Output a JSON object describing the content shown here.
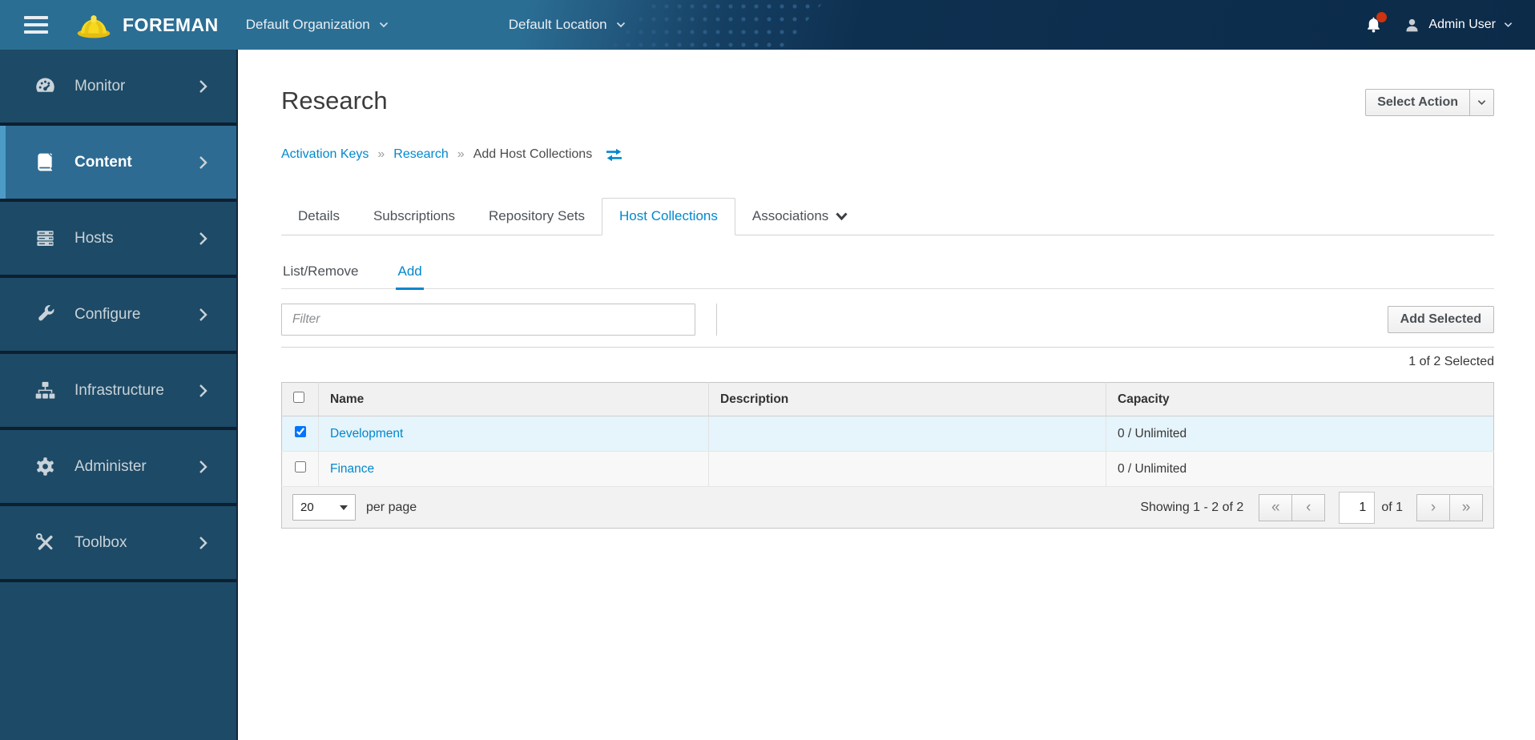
{
  "topbar": {
    "brand": "FOREMAN",
    "organization": "Default Organization",
    "location": "Default Location",
    "user": "Admin User"
  },
  "sidebar": {
    "items": [
      {
        "label": "Monitor",
        "icon": "gauge-icon"
      },
      {
        "label": "Content",
        "icon": "book-icon",
        "active": true
      },
      {
        "label": "Hosts",
        "icon": "servers-icon"
      },
      {
        "label": "Configure",
        "icon": "wrench-icon"
      },
      {
        "label": "Infrastructure",
        "icon": "sitemap-icon"
      },
      {
        "label": "Administer",
        "icon": "gear-icon"
      },
      {
        "label": "Toolbox",
        "icon": "tools-icon"
      }
    ]
  },
  "page": {
    "title": "Research",
    "select_action_label": "Select Action",
    "breadcrumb": {
      "items": [
        "Activation Keys",
        "Research",
        "Add Host Collections"
      ],
      "separator": "»"
    }
  },
  "tabs": {
    "items": [
      "Details",
      "Subscriptions",
      "Repository Sets",
      "Host Collections",
      "Associations"
    ],
    "active": "Host Collections"
  },
  "subtabs": {
    "items": [
      "List/Remove",
      "Add"
    ],
    "active": "Add"
  },
  "toolbar": {
    "filter_placeholder": "Filter",
    "add_selected_label": "Add Selected"
  },
  "selection_summary": "1 of 2 Selected",
  "table": {
    "header_checkbox_checked": false,
    "columns": [
      "Name",
      "Description",
      "Capacity"
    ],
    "rows": [
      {
        "checked": true,
        "name": "Development",
        "description": "",
        "capacity": "0 / Unlimited"
      },
      {
        "checked": false,
        "name": "Finance",
        "description": "",
        "capacity": "0 / Unlimited"
      }
    ]
  },
  "pagination": {
    "per_page": "20",
    "per_page_label": "per page",
    "showing": "Showing 1 - 2 of 2",
    "page_value": "1",
    "total_pages_label": "of 1",
    "first_glyph": "«",
    "prev_glyph": "‹",
    "next_glyph": "›",
    "last_glyph": "»"
  },
  "icons": {
    "menu": "hamburger-icon",
    "brand": "hardhat-icon",
    "dropdowns": "chevron-down-icon",
    "notifications": "bell-icon",
    "account": "user-icon",
    "sidebar_expand": "chevron-right-icon",
    "breadcrumb_switcher": "swap-arrows-icon",
    "associations_tab": "caret-down-icon"
  },
  "colors": {
    "accent_link": "#0088ce",
    "topbar_left": "#2b6e94",
    "topbar_right": "#0c2b49",
    "sidebar_bg": "#1d4a66",
    "sidebar_active_bg": "#2d6b92",
    "sidebar_active_strip": "#4c9bc7",
    "selected_row_bg": "#e6f4fb",
    "notification_badge": "#cc3311",
    "brand_hat_yellow": "#f6d91f"
  }
}
